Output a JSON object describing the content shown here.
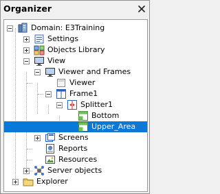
{
  "window": {
    "title": "Organizer"
  },
  "tree": {
    "domain": "Domain: E3Training",
    "settings": "Settings",
    "objects_library": "Objects Library",
    "view": "View",
    "viewer_and_frames": "Viewer and Frames",
    "viewer": "Viewer",
    "frame1": "Frame1",
    "splitter1": "Splitter1",
    "bottom": "Bottom",
    "upper_area": "Upper_Area",
    "screens": "Screens",
    "reports": "Reports",
    "resources": "Resources",
    "server_objects": "Server objects",
    "explorer": "Explorer"
  },
  "selected_item": "Upper_Area",
  "colors": {
    "selection": "#0a78d7",
    "folder": "#e8c25a"
  }
}
